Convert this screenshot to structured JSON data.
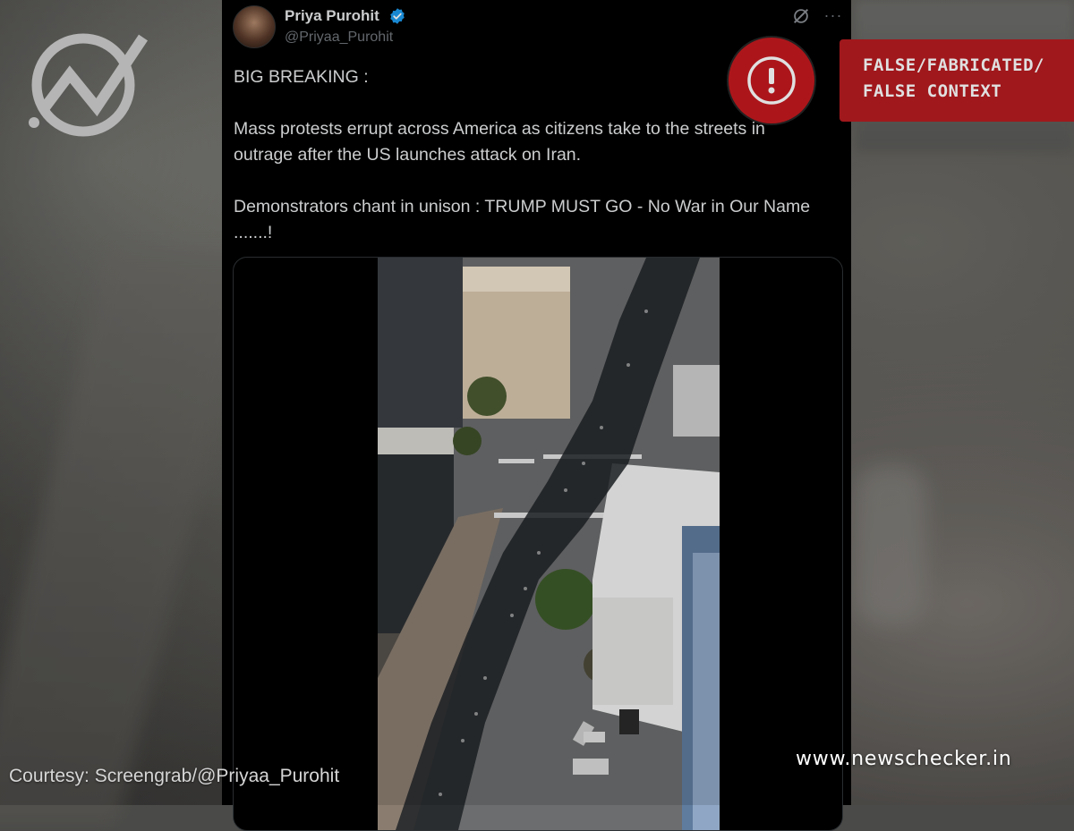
{
  "tweet": {
    "display_name": "Priya Purohit",
    "handle": "@Priyaa_Purohit",
    "text": "BIG BREAKING :\n\nMass protests errupt across America as citizens take to the streets in outrage after the US launches attack on Iran.\n\nDemonstrators chant in unison : TRUMP MUST GO - No War in Our Name .......!",
    "verified_icon": "verified-badge-icon",
    "grok_icon": "grok-icon",
    "more_icon": "more-icon",
    "more_glyph": "···"
  },
  "media": {
    "type": "video",
    "scene": "aerial-street-protest"
  },
  "verdict": {
    "line1": "FALSE/FABRICATED/",
    "line2": "FALSE CONTEXT",
    "icon": "alert-icon",
    "color": "#b71c20"
  },
  "brand": {
    "logo_icon": "newschecker-logo-icon",
    "site": "www.newschecker.in"
  },
  "credit": {
    "text": "Courtesy: Screengrab/@Priyaa_Purohit"
  },
  "colors": {
    "tweet_bg": "#000000",
    "text": "#e7e9ea",
    "muted": "#71767b",
    "verified": "#1d9bf0",
    "alert": "#c41a1f"
  }
}
